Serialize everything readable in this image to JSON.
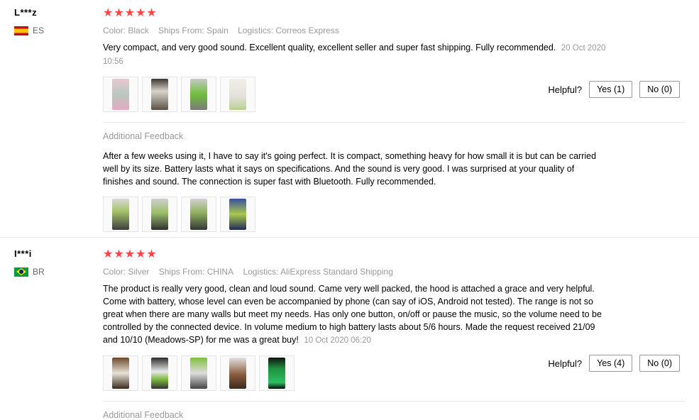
{
  "reviews": [
    {
      "username": "L***z",
      "country": "ES",
      "stars": "★★★★★",
      "color_label": "Color:",
      "color_value": "Black",
      "ships_label": "Ships From:",
      "ships_value": "Spain",
      "logistics_label": "Logistics:",
      "logistics_value": "Correos Express",
      "text": "Very compact, and very good sound. Excellent quality, excellent seller and super fast shipping. Fully recommended.",
      "date": "20 Oct 2020 10:56",
      "helpful_label": "Helpful?",
      "yes_label": "Yes (1)",
      "no_label": "No (0)",
      "additional_label": "Additional Feedback",
      "additional_text": "After a few weeks using it, I have to say it's going perfect. It is compact, something heavy for how small it is but can be carried well by its size. Battery lasts what it says on specifications. And the sound is very good. I was surprised at your quality of finishes and sound. The connection is super fast with Bluetooth. Fully recommended."
    },
    {
      "username": "I***i",
      "country": "BR",
      "stars": "★★★★★",
      "color_label": "Color:",
      "color_value": "Silver",
      "ships_label": "Ships From:",
      "ships_value": "CHINA",
      "logistics_label": "Logistics:",
      "logistics_value": "AliExpress Standard Shipping",
      "text": "The product is really very good, clean and loud sound. Came very well packed, the hood is attached a grace and very helpful. Come with battery, whose level can even be accompanied by phone (can say of iOS, Android not tested). The range is not so great when there are many walls but meet my needs. Has only one button, on/off or pause the music, so the volume need to be controlled by the connected device. In volume medium to high battery lasts about 5/6 hours. Made the request received 21/09 and 10/10 (Meadows-SP) for me was a great buy!",
      "date": "10 Oct 2020 06:20",
      "helpful_label": "Helpful?",
      "yes_label": "Yes (4)",
      "no_label": "No (0)",
      "additional_label": "Additional Feedback"
    }
  ],
  "colors": {
    "star": "#ff4747",
    "meta": "#999999"
  }
}
